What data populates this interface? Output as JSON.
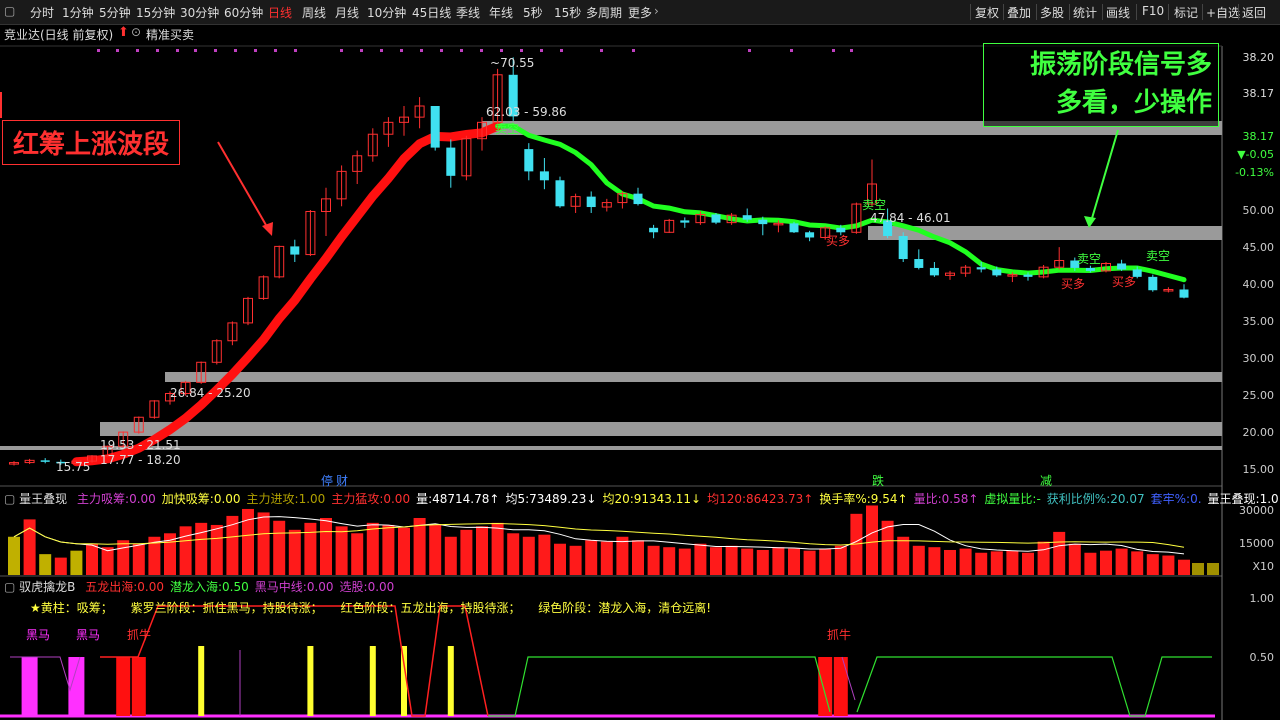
{
  "toolbar": {
    "left": [
      {
        "label": "分时"
      },
      {
        "label": "1分钟"
      },
      {
        "label": "5分钟"
      },
      {
        "label": "15分钟"
      },
      {
        "label": "30分钟"
      },
      {
        "label": "60分钟"
      },
      {
        "label": "日线",
        "active": true
      },
      {
        "label": "周线"
      },
      {
        "label": "月线"
      },
      {
        "label": "10分钟"
      },
      {
        "label": "45日线"
      },
      {
        "label": "季线"
      },
      {
        "label": "年线"
      },
      {
        "label": "5秒"
      },
      {
        "label": "15秒"
      },
      {
        "label": "多周期"
      },
      {
        "label": "更多"
      }
    ],
    "right": [
      {
        "label": "复权"
      },
      {
        "label": "叠加"
      },
      {
        "label": "多股"
      },
      {
        "label": "统计"
      },
      {
        "label": "画线"
      },
      {
        "label": "F10"
      },
      {
        "label": "标记"
      },
      {
        "label": "+自选"
      },
      {
        "label": "返回"
      }
    ]
  },
  "main": {
    "title": "竞业达(日线 前复权)",
    "indicator": "精准买卖",
    "price_labels": [
      "38.20",
      "38.17",
      "38.17",
      "▼-0.05",
      "-0.13%",
      "50.00",
      "45.00",
      "40.00",
      "35.00",
      "30.00",
      "25.00",
      "20.00",
      "15.00"
    ],
    "annotations": {
      "red_box": "红筹上涨波段",
      "green_box_line1": "振荡阶段信号多",
      "green_box_line2": "多看，少操作"
    },
    "price_marks": {
      "high": "70.55",
      "band1": "62.03 - 59.86",
      "band2": "47.84 - 46.01",
      "band3": "26.84 - 25.20",
      "band4": "19.53 - 21.51",
      "band5": "17.77 - 18.20",
      "low": "15.75"
    },
    "signals": {
      "sell_empty": "卖空",
      "buy_long": "买多",
      "event1": "停",
      "event2": "财",
      "event3": "跌",
      "event4": "减"
    }
  },
  "volume": {
    "name": "量王叠现",
    "fields": [
      {
        "label": "主力吸筹:",
        "value": "0.00",
        "color": "#d040d0"
      },
      {
        "label": "加快吸筹:",
        "value": "0.00",
        "color": "#ffff40"
      },
      {
        "label": "主力进攻:",
        "value": "1.00",
        "color": "#b0a000"
      },
      {
        "label": "主力猛攻:",
        "value": "0.00",
        "color": "#ff3030"
      },
      {
        "label": "量:",
        "value": "48714.78↑",
        "color": "#ffffff"
      },
      {
        "label": "均5:",
        "value": "73489.23↓",
        "color": "#ffffff"
      },
      {
        "label": "均20:",
        "value": "91343.11↓",
        "color": "#ffff40"
      },
      {
        "label": "均120:",
        "value": "86423.73↑",
        "color": "#ff3030"
      },
      {
        "label": "换手率%:",
        "value": "9.54↑",
        "color": "#ffff40"
      },
      {
        "label": "量比:",
        "value": "0.58↑",
        "color": "#d040d0"
      },
      {
        "label": "虚拟量比:",
        "value": "-",
        "color": "#40ff40"
      },
      {
        "label": "获利比例%:",
        "value": "20.07",
        "color": "#40c0c0"
      },
      {
        "label": "套牢%:",
        "value": "0.",
        "color": "#4060ff"
      },
      {
        "label": "量王叠现:",
        "value": "1.0",
        "color": "#ffffff"
      }
    ],
    "axis": [
      "30000",
      "15000",
      "X10"
    ]
  },
  "lower": {
    "name": "驭虎擒龙B",
    "fields": [
      {
        "label": "五龙出海:",
        "value": "0.00",
        "color": "#ff3030"
      },
      {
        "label": "潜龙入海:",
        "value": "0.50",
        "color": "#40ff40"
      },
      {
        "label": "黑马中线:",
        "value": "0.00",
        "color": "#d040d0"
      },
      {
        "label": "选股:",
        "value": "0.00",
        "color": "#d040d0"
      }
    ],
    "legend": [
      {
        "text": "★黄柱：吸筹；",
        "color": "#ffff40"
      },
      {
        "text": "紫罗兰阶段：抓住黑马，持股待涨；",
        "color": "#ffff40"
      },
      {
        "text": "红色阶段：五龙出海，持股待涨；",
        "color": "#ffff40"
      },
      {
        "text": "绿色阶段：潜龙入海，清仓远离!",
        "color": "#ffff40"
      }
    ],
    "tags": {
      "darkhorse": "黑马",
      "catch_cow": "抓牛"
    },
    "axis": [
      "1.00",
      "0.50"
    ]
  },
  "colors": {
    "up": "#ff3030",
    "down": "#40e0f0",
    "band": "#9a9a9a",
    "green_line": "#20ff20",
    "red_line": "#ff1010"
  },
  "candles": [
    [
      15.8,
      16.2,
      15.6,
      16.0
    ],
    [
      16.0,
      16.5,
      15.8,
      16.3
    ],
    [
      16.3,
      16.6,
      15.9,
      16.1
    ],
    [
      16.1,
      16.4,
      15.7,
      15.9
    ],
    [
      15.9,
      16.3,
      15.75,
      16.2
    ],
    [
      16.2,
      17.0,
      16.0,
      16.9
    ],
    [
      16.9,
      18.3,
      16.8,
      18.2
    ],
    [
      18.2,
      20.2,
      18.0,
      20.1
    ],
    [
      20.1,
      22.2,
      19.9,
      22.1
    ],
    [
      22.1,
      24.4,
      21.9,
      24.3
    ],
    [
      24.3,
      25.6,
      23.8,
      25.3
    ],
    [
      25.3,
      27.0,
      25.0,
      26.8
    ],
    [
      26.8,
      29.6,
      26.6,
      29.5
    ],
    [
      29.5,
      32.6,
      29.2,
      32.4
    ],
    [
      32.4,
      35.0,
      31.8,
      34.8
    ],
    [
      34.8,
      38.3,
      34.5,
      38.1
    ],
    [
      38.1,
      41.2,
      37.9,
      41.0
    ],
    [
      41.0,
      45.2,
      40.8,
      45.1
    ],
    [
      45.1,
      46.0,
      43.0,
      44.0
    ],
    [
      44.0,
      50.0,
      43.8,
      49.8
    ],
    [
      49.8,
      53.0,
      46.5,
      51.5
    ],
    [
      51.5,
      56.0,
      50.5,
      55.2
    ],
    [
      55.2,
      58.0,
      53.5,
      57.3
    ],
    [
      57.3,
      61.0,
      56.5,
      60.2
    ],
    [
      60.2,
      62.5,
      58.5,
      61.8
    ],
    [
      61.8,
      64.0,
      60.0,
      62.5
    ],
    [
      62.5,
      65.2,
      61.0,
      64.0
    ],
    [
      64.0,
      63.8,
      58.0,
      58.4
    ],
    [
      58.4,
      59.5,
      53.0,
      54.6
    ],
    [
      54.6,
      60.0,
      54.0,
      59.6
    ],
    [
      59.6,
      62.5,
      58.0,
      61.8
    ],
    [
      61.8,
      69.0,
      61.0,
      68.2
    ],
    [
      68.2,
      70.55,
      62.0,
      62.6
    ],
    [
      58.2,
      59.0,
      54.0,
      55.2
    ],
    [
      55.2,
      57.0,
      52.8,
      54.0
    ],
    [
      54.0,
      54.5,
      50.3,
      50.5
    ],
    [
      50.5,
      52.2,
      49.6,
      51.8
    ],
    [
      51.8,
      52.5,
      49.6,
      50.4
    ],
    [
      50.4,
      51.5,
      49.8,
      51.0
    ],
    [
      51.0,
      52.5,
      50.2,
      52.2
    ],
    [
      52.2,
      53.0,
      50.6,
      50.8
    ],
    [
      47.6,
      48.0,
      46.2,
      47.0
    ],
    [
      47.0,
      48.8,
      46.9,
      48.6
    ],
    [
      48.6,
      49.0,
      47.6,
      48.3
    ],
    [
      48.3,
      49.8,
      48.0,
      49.4
    ],
    [
      49.4,
      49.6,
      48.1,
      48.3
    ],
    [
      48.3,
      49.6,
      48.0,
      49.3
    ],
    [
      49.3,
      50.2,
      48.4,
      48.7
    ],
    [
      48.7,
      49.1,
      46.6,
      48.1
    ],
    [
      48.1,
      48.6,
      47.0,
      48.2
    ],
    [
      48.2,
      48.4,
      46.9,
      47.0
    ],
    [
      47.0,
      47.2,
      45.8,
      46.3
    ],
    [
      46.3,
      47.8,
      46.0,
      47.6
    ],
    [
      47.6,
      48.0,
      46.6,
      47.0
    ],
    [
      47.0,
      51.0,
      46.8,
      50.8
    ],
    [
      50.8,
      56.8,
      50.5,
      53.5
    ],
    [
      48.6,
      50.2,
      46.2,
      46.5
    ],
    [
      46.5,
      47.0,
      43.0,
      43.4
    ],
    [
      43.4,
      44.7,
      42.0,
      42.2
    ],
    [
      42.2,
      43.0,
      41.0,
      41.2
    ],
    [
      41.2,
      41.8,
      40.6,
      41.5
    ],
    [
      41.5,
      42.6,
      41.0,
      42.3
    ],
    [
      42.3,
      43.0,
      41.6,
      42.0
    ],
    [
      42.0,
      42.4,
      41.0,
      41.2
    ],
    [
      41.2,
      41.6,
      40.3,
      41.3
    ],
    [
      41.3,
      41.6,
      40.5,
      41.0
    ],
    [
      41.0,
      42.6,
      40.8,
      42.3
    ],
    [
      42.3,
      45.0,
      42.0,
      43.2
    ],
    [
      43.2,
      43.6,
      41.8,
      42.2
    ],
    [
      42.2,
      42.5,
      41.6,
      41.8
    ],
    [
      41.8,
      43.0,
      41.6,
      42.8
    ],
    [
      42.8,
      43.3,
      41.8,
      42.0
    ],
    [
      42.0,
      42.4,
      40.8,
      41.0
    ],
    [
      41.0,
      41.3,
      39.0,
      39.2
    ],
    [
      39.2,
      39.6,
      38.9,
      39.3
    ],
    [
      39.3,
      40.0,
      38.1,
      38.2
    ]
  ],
  "vol": [
    0.55,
    0.8,
    0.3,
    0.25,
    0.35,
    0.45,
    0.4,
    0.5,
    0.45,
    0.55,
    0.6,
    0.7,
    0.75,
    0.72,
    0.85,
    0.95,
    0.9,
    0.78,
    0.65,
    0.75,
    0.82,
    0.7,
    0.6,
    0.75,
    0.72,
    0.68,
    0.82,
    0.72,
    0.55,
    0.65,
    0.7,
    0.75,
    0.6,
    0.55,
    0.58,
    0.45,
    0.42,
    0.5,
    0.48,
    0.55,
    0.5,
    0.42,
    0.4,
    0.38,
    0.45,
    0.4,
    0.42,
    0.38,
    0.36,
    0.4,
    0.38,
    0.35,
    0.38,
    0.42,
    0.88,
    1.0,
    0.78,
    0.55,
    0.42,
    0.4,
    0.36,
    0.38,
    0.32,
    0.34,
    0.35,
    0.32,
    0.48,
    0.62,
    0.45,
    0.32,
    0.35,
    0.38,
    0.34,
    0.3,
    0.28,
    0.22
  ]
}
